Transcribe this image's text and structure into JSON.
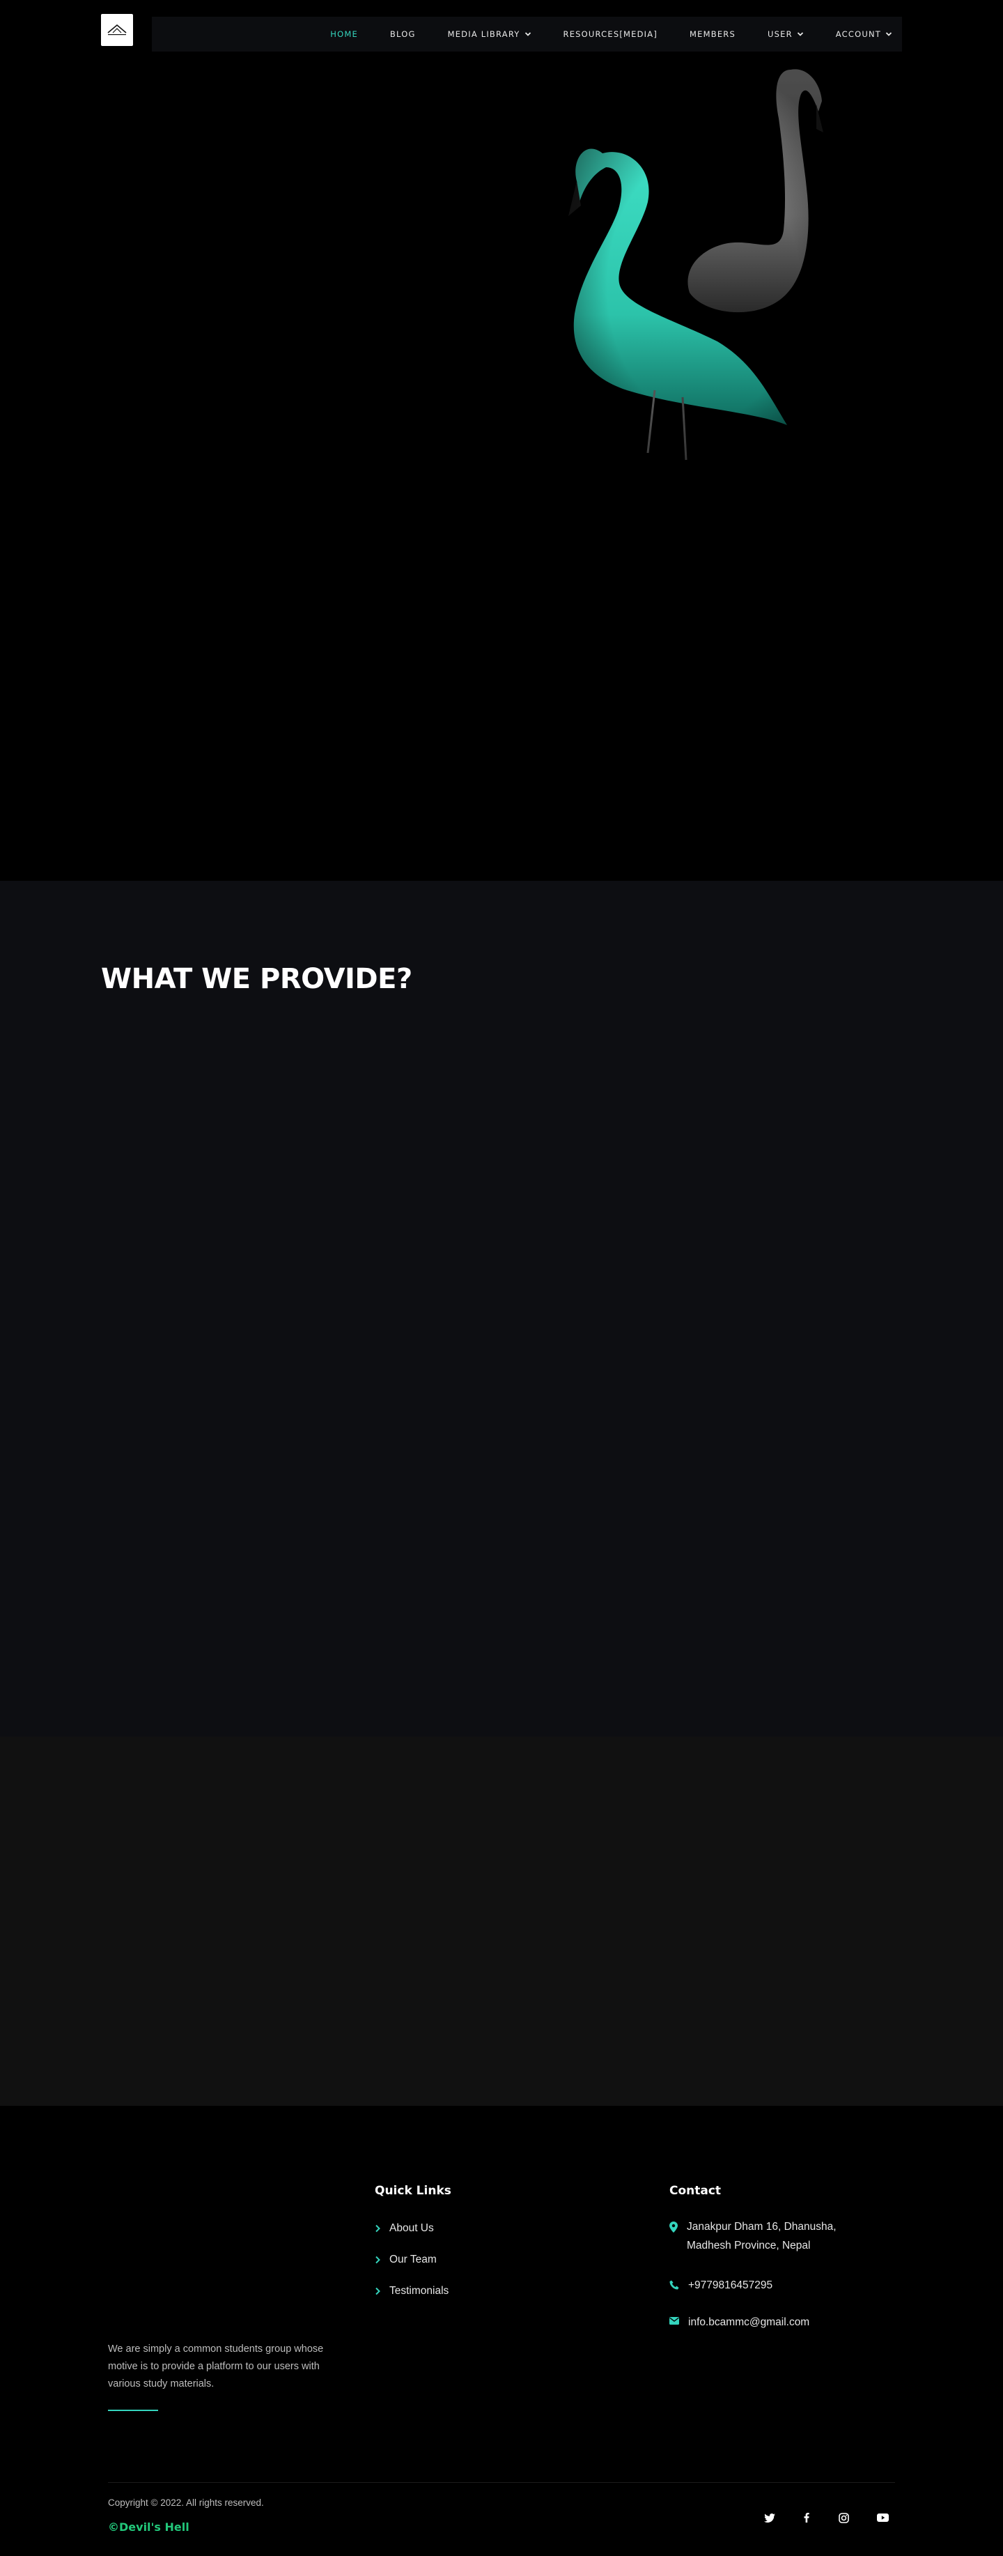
{
  "nav": {
    "items": [
      {
        "label": "HOME",
        "active": true,
        "dropdown": false
      },
      {
        "label": "BLOG",
        "active": false,
        "dropdown": false
      },
      {
        "label": "MEDIA LIBRARY",
        "active": false,
        "dropdown": true
      },
      {
        "label": "RESOURCES[MEDIA]",
        "active": false,
        "dropdown": false
      },
      {
        "label": "MEMBERS",
        "active": false,
        "dropdown": false
      },
      {
        "label": "USER",
        "active": false,
        "dropdown": true
      },
      {
        "label": "ACCOUNT",
        "active": false,
        "dropdown": true
      }
    ]
  },
  "provide": {
    "heading": "WHAT WE PROVIDE?"
  },
  "footer": {
    "about": "We are simply a common students group whose motive is to provide a platform to our users with various study materials.",
    "quick_links": {
      "heading": "Quick Links",
      "items": [
        "About Us",
        "Our Team",
        "Testimonials"
      ]
    },
    "contact": {
      "heading": "Contact",
      "address": "Janakpur Dham 16, Dhanusha, Madhesh Province, Nepal",
      "phone": "+9779816457295",
      "email": "info.bcammc@gmail.com"
    },
    "copyright": "Copyright © 2022. All rights reserved.",
    "brand": "©Devil's Hell",
    "social": [
      "twitter-icon",
      "facebook-icon",
      "instagram-icon",
      "youtube-icon"
    ]
  },
  "colors": {
    "accent": "#34d4bd",
    "brand_green": "#22c77a",
    "nav_bg": "#0c0d10",
    "provide_bg": "#0d0e12",
    "band_bg": "#111111"
  }
}
